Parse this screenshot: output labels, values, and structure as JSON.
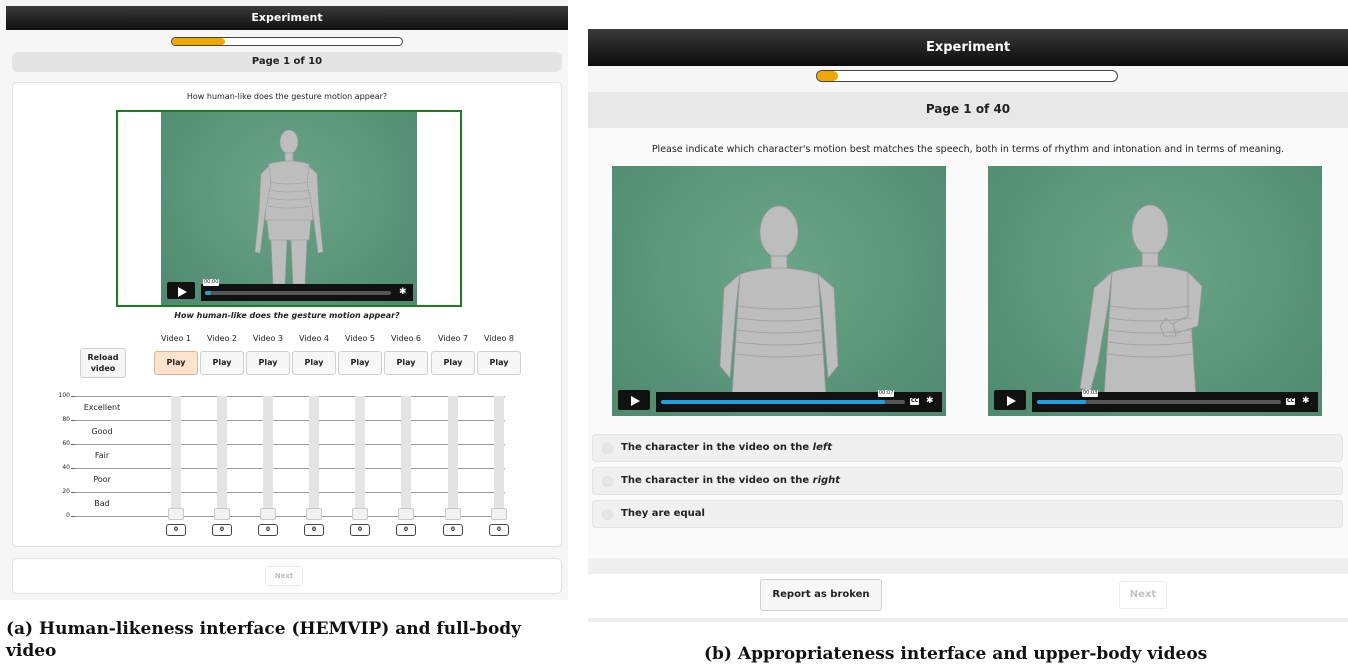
{
  "left": {
    "title": "Experiment",
    "progress": 0.23,
    "page_label": "Page 1 of 10",
    "question": "How human-like does the gesture motion appear?",
    "video": {
      "time": "00:00",
      "progress": 0.03
    },
    "question_italic": "How human-like does the gesture motion appear?",
    "reload_label": "Reload video",
    "video_labels": [
      "Video 1",
      "Video 2",
      "Video 3",
      "Video 4",
      "Video 5",
      "Video 6",
      "Video 7",
      "Video 8"
    ],
    "play_label": "Play",
    "active_play": 0,
    "scale_ticks": [
      "100",
      "80",
      "60",
      "40",
      "20",
      "0"
    ],
    "scale_labels": [
      "Excellent",
      "Good",
      "Fair",
      "Poor",
      "Bad"
    ],
    "slider_values": [
      "0",
      "0",
      "0",
      "0",
      "0",
      "0",
      "0",
      "0"
    ],
    "next_label": "Next",
    "caption": "(a) Human-likeness interface (HEMVIP) and full-body video"
  },
  "right": {
    "title": "Experiment",
    "progress": 0.07,
    "page_label": "Page 1 of 40",
    "question": "Please indicate which character's motion best matches the speech, both in terms of rhythm and intonation and in terms of meaning.",
    "videos": [
      {
        "time": "00:07",
        "progress": 0.92
      },
      {
        "time": "00:03",
        "progress": 0.2
      }
    ],
    "cc_label": "CC",
    "options": [
      {
        "prefix": "The character in the video on the ",
        "emph": "left"
      },
      {
        "prefix": "The character in the video on the ",
        "emph": "right"
      },
      {
        "prefix": "They are equal",
        "emph": ""
      }
    ],
    "report_label": "Report as broken",
    "next_label": "Next",
    "caption": "(b) Appropriateness interface and upper-body videos"
  },
  "colors": {
    "accent": "#f0a800",
    "seek": "#1ea0e0",
    "video_border": "#1c7d1c",
    "scene": "#5a9479"
  }
}
